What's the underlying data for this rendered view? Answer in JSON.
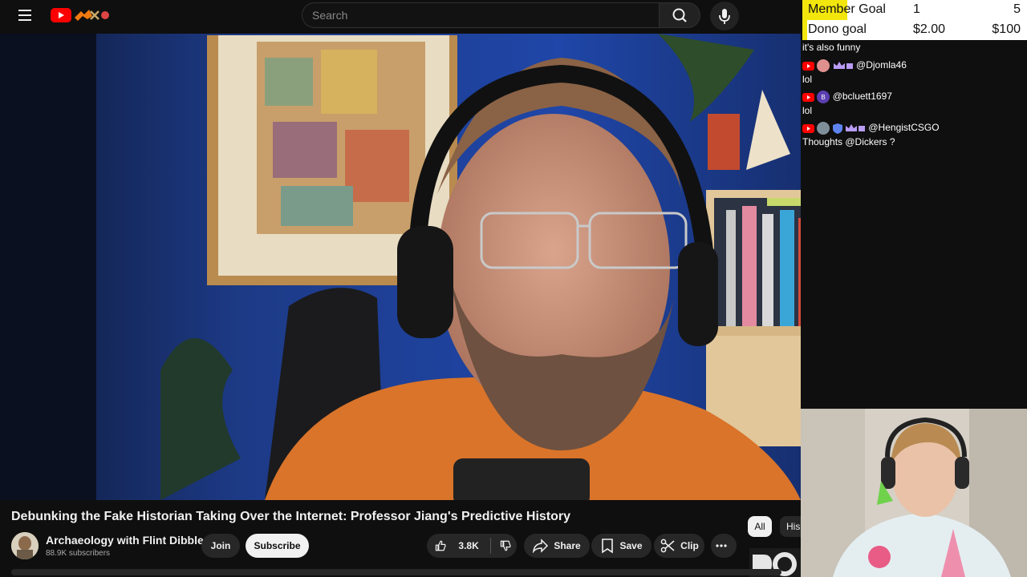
{
  "topbar": {
    "search_placeholder": "Search"
  },
  "overlay": {
    "goals": [
      {
        "label": "Member Goal",
        "current": "1",
        "target": "5",
        "progress": 0.2
      },
      {
        "label": "Dono goal",
        "current": "$2.00",
        "target": "$100",
        "progress": 0.02
      }
    ],
    "colors": {
      "goal_fill": "#f2e60c",
      "goal_bg": "#ffffff"
    }
  },
  "chat": {
    "messages": [
      {
        "user": "",
        "text": "it's also funny"
      },
      {
        "user": "@Djomla46",
        "text": "lol"
      },
      {
        "user": "@bcluett1697",
        "text": "lol"
      },
      {
        "user": "@HengistCSGO",
        "text": "Thoughts @Dickers ?"
      }
    ]
  },
  "video": {
    "title": "Debunking the Fake Historian Taking Over the Internet: Professor Jiang's Predictive History"
  },
  "channel": {
    "name": "Archaeology with Flint Dibble",
    "subscribers": "88.9K subscribers",
    "join_label": "Join",
    "subscribe_label": "Subscribe"
  },
  "actions": {
    "like_count": "3.8K",
    "share_label": "Share",
    "save_label": "Save",
    "clip_label": "Clip"
  },
  "chips": {
    "all_label": "All",
    "next_label": "His"
  },
  "icons": [
    "menu-icon",
    "youtube-logo",
    "search-icon",
    "mic-icon",
    "like-icon",
    "dislike-icon",
    "share-icon",
    "save-icon",
    "clip-icon",
    "more-icon",
    "youtube-badge-icon",
    "crown-badge-icon",
    "shield-badge-icon"
  ]
}
